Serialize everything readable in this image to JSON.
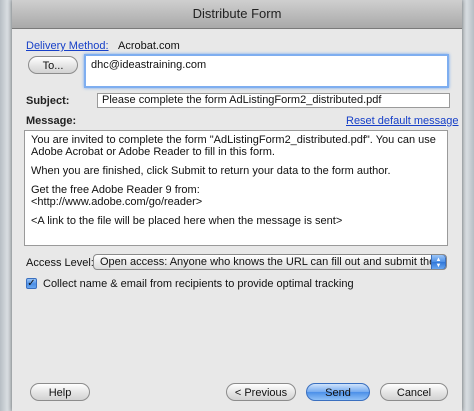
{
  "window": {
    "title": "Distribute Form"
  },
  "delivery": {
    "label": "Delivery Method:",
    "value": "Acrobat.com"
  },
  "recipients": {
    "to_button": "To...",
    "to_value": "dhc@ideastraining.com"
  },
  "subject": {
    "label": "Subject:",
    "value": "Please complete the form AdListingForm2_distributed.pdf"
  },
  "message": {
    "label": "Message:",
    "reset_link": "Reset default message",
    "paragraphs": [
      "You are invited to complete the form \"AdListingForm2_distributed.pdf\". You can use Adobe Acrobat or Adobe Reader to fill in this form.",
      "When you are finished, click Submit to return your data to the form author.",
      "Get the free Adobe Reader 9 from:",
      "<http://www.adobe.com/go/reader>",
      "<A link to the file will be placed here when the message is sent>"
    ]
  },
  "access": {
    "label": "Access Level:",
    "selected": "Open access: Anyone who knows the URL can fill out and submit the form"
  },
  "tracking": {
    "label": "Collect name & email from recipients to provide optimal tracking",
    "checked": true
  },
  "buttons": {
    "help": "Help",
    "previous": "< Previous",
    "send": "Send",
    "cancel": "Cancel"
  },
  "colors": {
    "link": "#1740c8",
    "focus_ring": "#7eaef0",
    "default_button": "#4b8fe8"
  }
}
